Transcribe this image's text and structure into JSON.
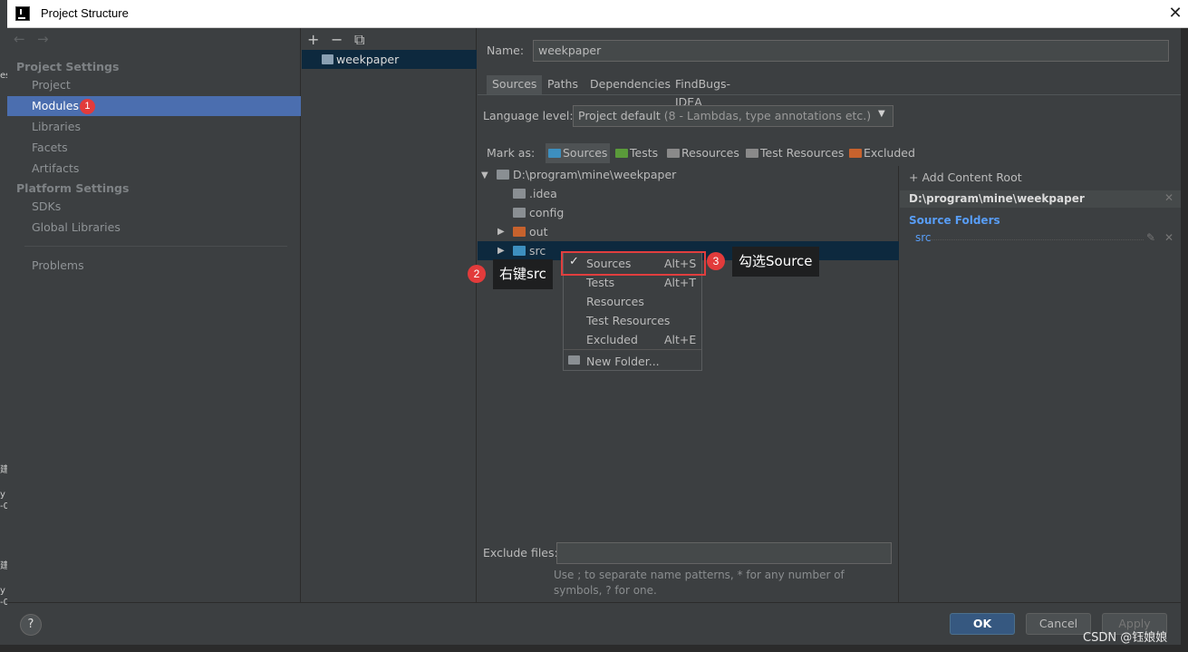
{
  "window": {
    "title": "Project Structure",
    "close_glyph": "✕"
  },
  "outside": {
    "labels": [
      "es",
      "建",
      "y",
      "-0",
      "建",
      "y",
      "-0"
    ]
  },
  "nav": {
    "back_glyph": "←",
    "forward_glyph": "→",
    "project_settings": "Project Settings",
    "items_ps": [
      "Project",
      "Modules",
      "Libraries",
      "Facets",
      "Artifacts"
    ],
    "platform_settings": "Platform Settings",
    "items_plat": [
      "SDKs",
      "Global Libraries"
    ],
    "problems": "Problems",
    "modules_badge": "1"
  },
  "modules": {
    "add": "+",
    "remove": "−",
    "copy": "⧉",
    "item": "weekpaper"
  },
  "main": {
    "name_label": "Name:",
    "name_value": "weekpaper",
    "tabs": [
      "Sources",
      "Paths",
      "Dependencies",
      "FindBugs-IDEA"
    ],
    "language_label": "Language level:",
    "language_value": "Project default",
    "language_detail": "(8 - Lambdas, type annotations etc.)",
    "mark_as": "Mark as:",
    "mark_buttons": [
      "Sources",
      "Tests",
      "Resources",
      "Test Resources",
      "Excluded"
    ],
    "colors": {
      "sources": "#3d8fbf",
      "tests": "#5a9a3a",
      "resources": "#8a8a8a",
      "excluded": "#c7622d",
      "folder": "#8a8f93"
    }
  },
  "tree": {
    "root": "D:\\program\\mine\\weekpaper",
    "items": [
      ".idea",
      "config",
      "out",
      "src"
    ]
  },
  "context_menu": {
    "items": [
      {
        "label": "Sources",
        "shortcut": "Alt+S"
      },
      {
        "label": "Tests",
        "shortcut": "Alt+T"
      },
      {
        "label": "Resources",
        "shortcut": ""
      },
      {
        "label": "Test Resources",
        "shortcut": ""
      },
      {
        "label": "Excluded",
        "shortcut": "Alt+E"
      }
    ],
    "new_folder": "New Folder...",
    "check_glyph": "✓"
  },
  "annotations": {
    "step2_badge": "2",
    "step2_text": "右键src",
    "step3_badge": "3",
    "step3_text": "勾选Source"
  },
  "content_root": {
    "add_label": "+ Add Content Root",
    "path": "D:\\program\\mine\\weekpaper",
    "source_folders_head": "Source Folders",
    "source_folders": [
      "src"
    ]
  },
  "exclude": {
    "label": "Exclude files:",
    "hint": "Use ; to separate name patterns, * for any number of symbols, ? for one."
  },
  "buttons": {
    "help": "?",
    "ok": "OK",
    "cancel": "Cancel",
    "apply": "Apply"
  },
  "watermark": "CSDN @钰娘娘"
}
